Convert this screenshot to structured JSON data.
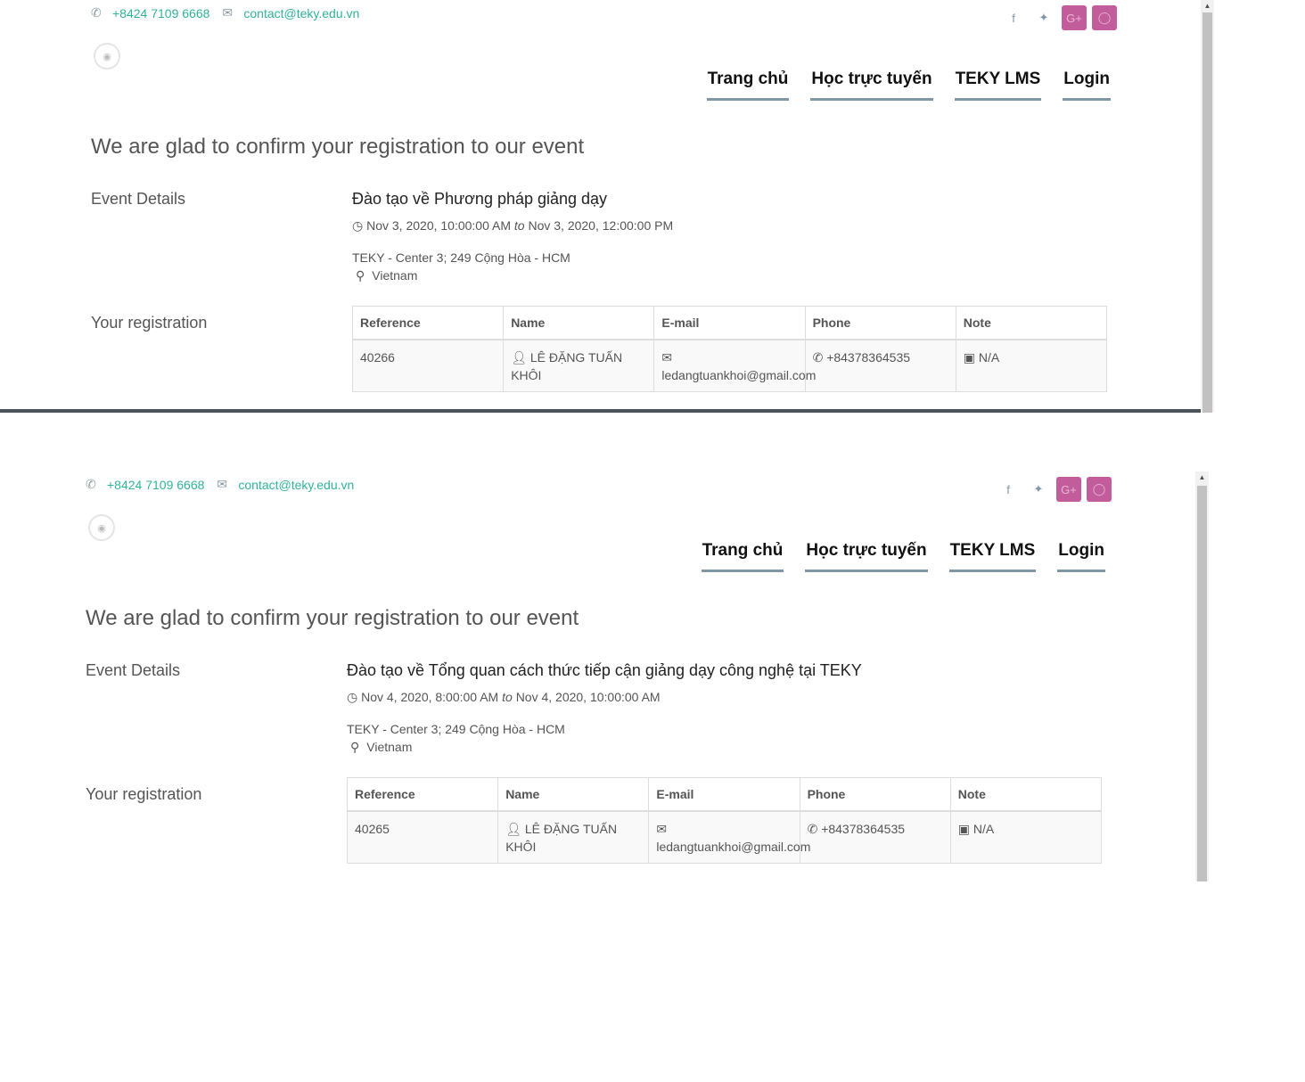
{
  "colors": {
    "link": "#31b39a",
    "nav_underline": "#7f97a6",
    "social_accent": "#c25c9b",
    "divider": "#4a5359"
  },
  "header": {
    "phone": "+8424 7109 6668",
    "email": "contact@teky.edu.vn",
    "social_icons": [
      "facebook-icon",
      "twitter-icon",
      "google-plus-icon",
      "github-icon"
    ],
    "nav": [
      "Trang chủ",
      "Học trực tuyến",
      "TEKY LMS",
      "Login"
    ]
  },
  "labels": {
    "headline": "We are glad to confirm your registration to our event",
    "event_details": "Event Details",
    "your_registration": "Your registration",
    "to": "to"
  },
  "table_headers": [
    "Reference",
    "Name",
    "E-mail",
    "Phone",
    "Note"
  ],
  "confirmations": [
    {
      "event_title": "Đào tạo về Phương pháp giảng dạy",
      "start": "Nov 3, 2020, 10:00:00 AM",
      "end": "Nov 3, 2020, 12:00:00 PM",
      "address": "TEKY - Center 3; 249 Cộng Hòa - HCM",
      "country": "Vietnam",
      "row": {
        "reference": "40266",
        "name": "LÊ ĐẶNG TUẤN KHÔI",
        "email": "ledangtuankhoi@gmail.com",
        "phone": "+84378364535",
        "note": "N/A"
      }
    },
    {
      "event_title": "Đào tạo về Tổng quan cách thức tiếp cận giảng dạy công nghệ tại TEKY",
      "start": "Nov 4, 2020, 8:00:00 AM",
      "end": "Nov 4, 2020, 10:00:00 AM",
      "address": "TEKY - Center 3; 249 Cộng Hòa - HCM",
      "country": "Vietnam",
      "row": {
        "reference": "40265",
        "name": "LÊ ĐẶNG TUẤN KHÔI",
        "email": "ledangtuankhoi@gmail.com",
        "phone": "+84378364535",
        "note": "N/A"
      }
    }
  ]
}
